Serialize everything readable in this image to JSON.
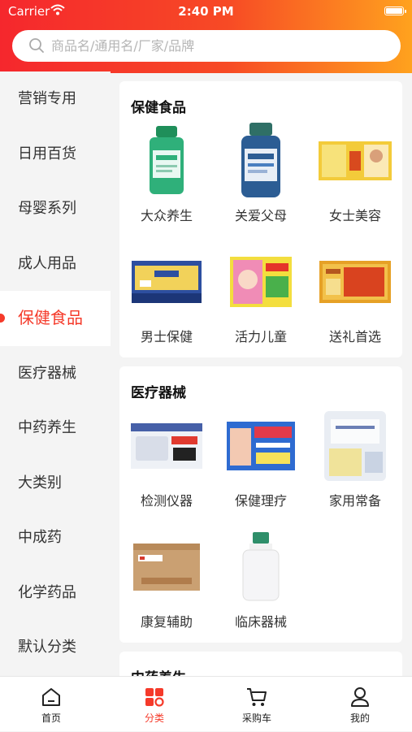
{
  "status_bar": {
    "carrier": "Carrier",
    "time": "2:40 PM"
  },
  "search": {
    "placeholder": "商品名/通用名/厂家/品牌"
  },
  "sidebar": {
    "items": [
      {
        "label": "营销专用"
      },
      {
        "label": "日用百货"
      },
      {
        "label": "母婴系列"
      },
      {
        "label": "成人用品"
      },
      {
        "label": "保健食品",
        "active": true
      },
      {
        "label": "医疗器械"
      },
      {
        "label": "中药养生"
      },
      {
        "label": "大类别"
      },
      {
        "label": "中成药"
      },
      {
        "label": "化学药品"
      },
      {
        "label": "默认分类"
      }
    ]
  },
  "sections": [
    {
      "title": "保健食品",
      "products": [
        {
          "label": "大众养生"
        },
        {
          "label": "关爱父母"
        },
        {
          "label": "女士美容"
        },
        {
          "label": "男士保健"
        },
        {
          "label": "活力儿童"
        },
        {
          "label": "送礼首选"
        }
      ]
    },
    {
      "title": "医疗器械",
      "products": [
        {
          "label": "检测仪器"
        },
        {
          "label": "保健理疗"
        },
        {
          "label": "家用常备"
        },
        {
          "label": "康复辅助"
        },
        {
          "label": "临床器械"
        }
      ]
    },
    {
      "title": "中药养生"
    }
  ],
  "tabbar": {
    "items": [
      {
        "label": "首页",
        "icon": "home-icon"
      },
      {
        "label": "分类",
        "icon": "category-icon",
        "active": true
      },
      {
        "label": "采购车",
        "icon": "cart-icon"
      },
      {
        "label": "我的",
        "icon": "profile-icon"
      }
    ]
  },
  "colors": {
    "accent": "#f53a2a",
    "header_start": "#f5272d",
    "header_end": "#ffa21e"
  }
}
